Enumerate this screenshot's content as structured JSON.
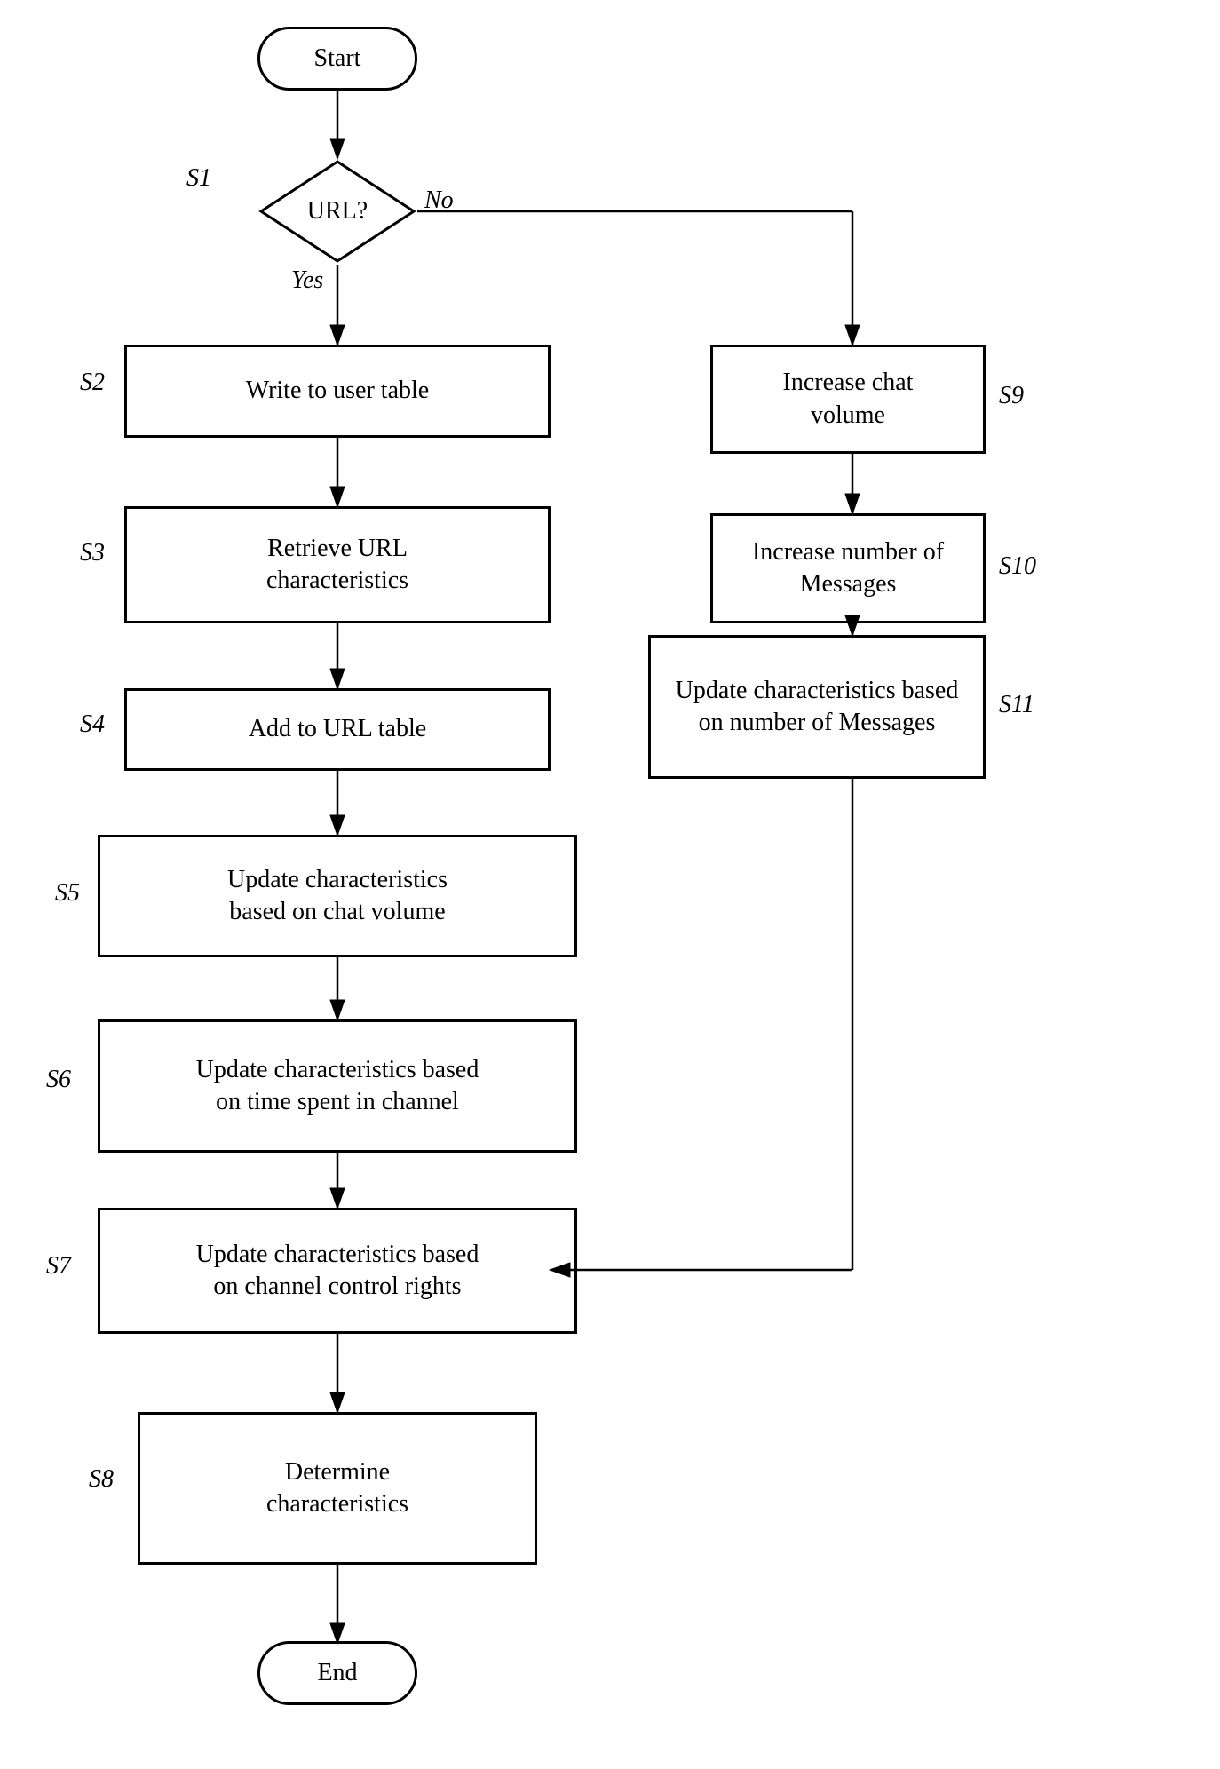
{
  "nodes": {
    "start": {
      "label": "Start"
    },
    "url_decision": {
      "label": "URL?"
    },
    "s1_label": "S1",
    "yes_label": "Yes",
    "no_label": "No",
    "s2_label": "S2",
    "s2": {
      "label": "Write to user table"
    },
    "s3_label": "S3",
    "s3": {
      "label": "Retrieve URL\ncharacteristics"
    },
    "s4_label": "S4",
    "s4": {
      "label": "Add to URL table"
    },
    "s5_label": "S5",
    "s5": {
      "label": "Update characteristics\nbased on chat volume"
    },
    "s6_label": "S6",
    "s6": {
      "label": "Update characteristics based\non time spent in channel"
    },
    "s7_label": "S7",
    "s7": {
      "label": "Update characteristics based\non channel control rights"
    },
    "s8_label": "S8",
    "s8": {
      "label": "Determine\ncharacteristics"
    },
    "end": {
      "label": "End"
    },
    "s9_label": "S9",
    "s9": {
      "label": "Increase chat\nvolume"
    },
    "s10_label": "S10",
    "s10": {
      "label": "Increase number of\nMessages"
    },
    "s11_label": "S11",
    "s11": {
      "label": "Update characteristics based\non number of Messages"
    }
  }
}
